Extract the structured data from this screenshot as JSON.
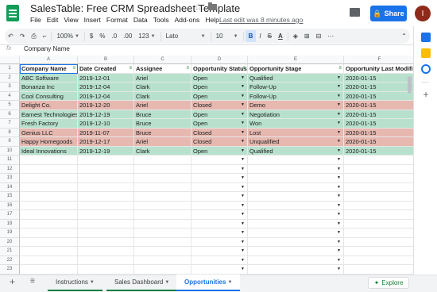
{
  "title": "SalesTable: Free CRM Spreadsheet Template",
  "menu": [
    "File",
    "Edit",
    "View",
    "Insert",
    "Format",
    "Data",
    "Tools",
    "Add-ons",
    "Help"
  ],
  "last_edit": "Last edit was 8 minutes ago",
  "share_label": "Share",
  "avatar_initial": "I",
  "toolbar": {
    "zoom": "100%",
    "currency": "$",
    "percent": "%",
    "dec_less": ".0",
    "dec_more": ".00",
    "format_more": "123",
    "font": "Lato",
    "font_size": "10",
    "bold": "B",
    "italic": "I",
    "strike": "S",
    "text_color": "A"
  },
  "formula_bar": {
    "fx": "fx",
    "value": "Company Name"
  },
  "columns": [
    "A",
    "B",
    "C",
    "D",
    "E",
    "F"
  ],
  "headers": [
    "Company Name",
    "Date Created",
    "Assignee",
    "Opportunity Status",
    "Opportunity Stage",
    "Opportunity Last Modifie"
  ],
  "rows": [
    {
      "n": "2",
      "cells": [
        "ABC Software",
        "2019-12-01",
        "Ariel",
        "Open",
        "Qualified",
        "2020-01-15"
      ],
      "status": "open"
    },
    {
      "n": "3",
      "cells": [
        "Bonanza Inc",
        "2019-12-04",
        "Clark",
        "Open",
        "Follow-Up",
        "2020-01-15"
      ],
      "status": "open"
    },
    {
      "n": "4",
      "cells": [
        "Cool Consulting",
        "2019-12-04",
        "Clark",
        "Open",
        "Follow-Up",
        "2020-01-15"
      ],
      "status": "open"
    },
    {
      "n": "5",
      "cells": [
        "Delight Co.",
        "2019-12-20",
        "Ariel",
        "Closed",
        "Demo",
        "2020-01-15"
      ],
      "status": "closed"
    },
    {
      "n": "6",
      "cells": [
        "Earnest Technologies",
        "2019-12-19",
        "Bruce",
        "Open",
        "Negotiation",
        "2020-01-15"
      ],
      "status": "open"
    },
    {
      "n": "7",
      "cells": [
        "Fresh Factory",
        "2019-12-10",
        "Bruce",
        "Open",
        "Won",
        "2020-01-15"
      ],
      "status": "open"
    },
    {
      "n": "8",
      "cells": [
        "Genius LLC",
        "2019-11-07",
        "Bruce",
        "Closed",
        "Lost",
        "2020-01-15"
      ],
      "status": "closed"
    },
    {
      "n": "9",
      "cells": [
        "Happy Homegoods",
        "2019-12-17",
        "Ariel",
        "Closed",
        "Unqualified",
        "2020-01-15"
      ],
      "status": "closed"
    },
    {
      "n": "10",
      "cells": [
        "Ideal Innovations",
        "2019-12-19",
        "Clark",
        "Open",
        "Qualified",
        "2020-01-15"
      ],
      "status": "open"
    }
  ],
  "header_row_number": "1",
  "empty_row_numbers": [
    "11",
    "12",
    "13",
    "14",
    "15",
    "16",
    "17",
    "18",
    "19",
    "20",
    "21",
    "22",
    "23"
  ],
  "colors": {
    "open": "#b7e1cd",
    "closed": "#e6b8af",
    "accent": "#1a73e8",
    "brand_green": "#0f9d58"
  },
  "sheet_tabs": [
    "Instructions",
    "Sales Dashboard",
    "Opportunities"
  ],
  "active_tab": "Opportunities",
  "explore_label": "Explore"
}
